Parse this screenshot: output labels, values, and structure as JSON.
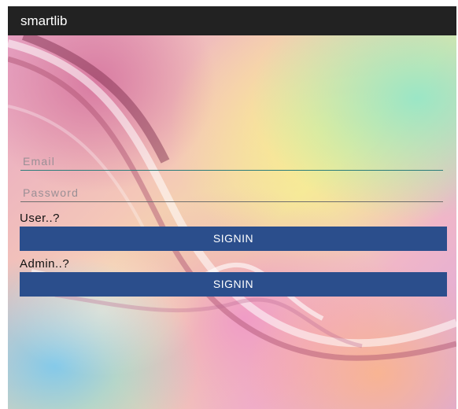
{
  "app": {
    "title": "smartlib"
  },
  "login": {
    "email_placeholder": "Email",
    "password_placeholder": "Password",
    "user_label": "User..?",
    "user_signin_label": "SIGNIN",
    "admin_label": "Admin..?",
    "admin_signin_label": "SIGNIN"
  },
  "colors": {
    "appbar": "#222222",
    "button": "#2b4e8c",
    "email_underline": "#2a7c7a"
  }
}
